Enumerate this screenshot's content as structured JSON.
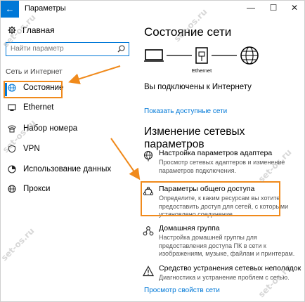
{
  "window": {
    "title": "Параметры",
    "back_glyph": "←",
    "minimize_glyph": "—",
    "maximize_glyph": "☐",
    "close_glyph": "✕"
  },
  "sidebar": {
    "home_label": "Главная",
    "search_placeholder": "Найти параметр",
    "section_label": "Сеть и Интернет",
    "items": [
      {
        "label": "Состояние",
        "icon": "globe-icon",
        "active": true
      },
      {
        "label": "Ethernet",
        "icon": "ethernet-icon",
        "active": false
      },
      {
        "label": "Набор номера",
        "icon": "dialup-icon",
        "active": false
      },
      {
        "label": "VPN",
        "icon": "vpn-icon",
        "active": false
      },
      {
        "label": "Использование данных",
        "icon": "data-usage-icon",
        "active": false
      },
      {
        "label": "Прокси",
        "icon": "globe-icon",
        "active": false
      }
    ]
  },
  "main": {
    "status_title": "Состояние сети",
    "diagram": {
      "adapter_label": "Ethernet"
    },
    "connected_text": "Вы подключены к Интернету",
    "show_networks_link": "Показать доступные сети",
    "change_title": "Изменение сетевых параметров",
    "settings": [
      {
        "title": "Настройка параметров адаптера",
        "desc": "Просмотр сетевых адаптеров и изменение параметров подключения.",
        "icon": "adapter-icon"
      },
      {
        "title": "Параметры общего доступа",
        "desc": "Определите, к каким ресурсам вы хотите предоставить доступ для сетей, с которыми установлено соединение.",
        "icon": "sharing-icon"
      },
      {
        "title": "Домашняя группа",
        "desc": "Настройка домашней группы для предоставления доступа ПК в сети к изображениям, музыке, файлам и принтерам.",
        "icon": "homegroup-icon"
      },
      {
        "title": "Средство устранения сетевых неполадок",
        "desc": "Диагностика и устранение проблем с сетью.",
        "icon": "warning-icon"
      }
    ],
    "view_properties_link": "Просмотр свойств сети"
  },
  "colors": {
    "accent": "#0078d7",
    "highlight": "#f08a1c"
  }
}
